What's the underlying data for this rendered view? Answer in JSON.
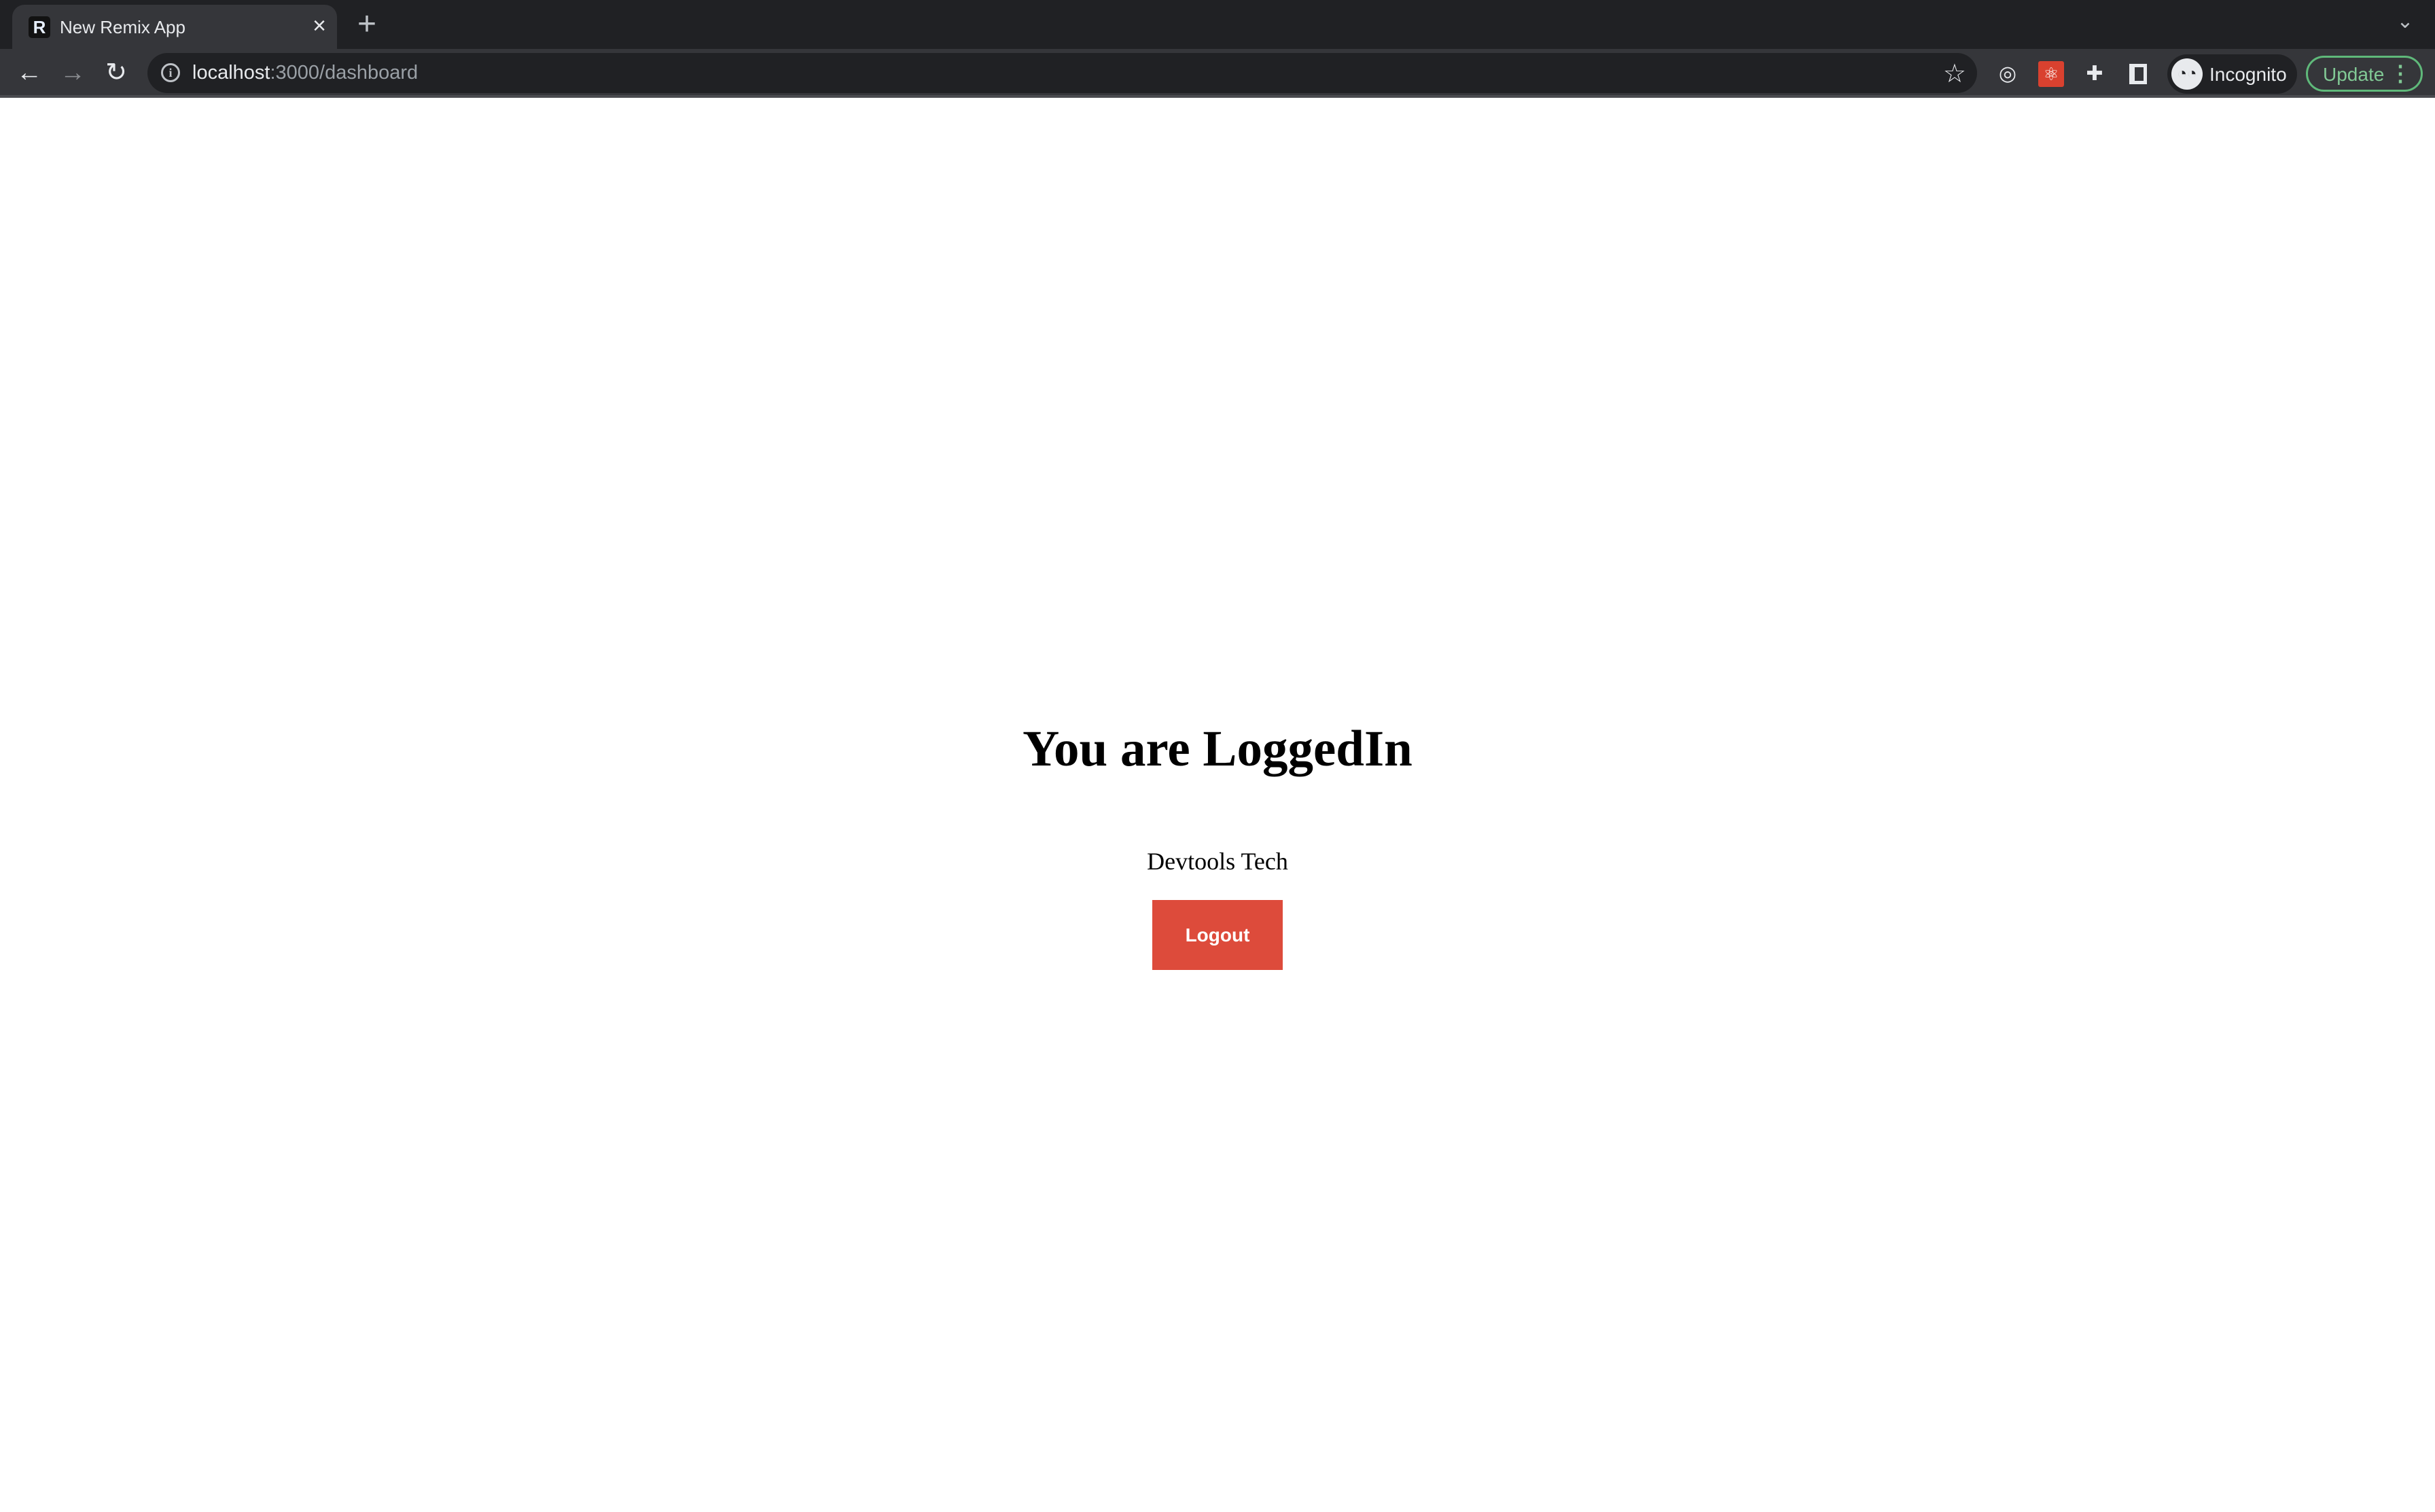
{
  "browser": {
    "tab": {
      "title": "New Remix App",
      "favicon": "R",
      "close": "×"
    },
    "new_tab": "+",
    "tab_search": "⌄",
    "address": {
      "host": "localhost",
      "path": ":3000/dashboard"
    },
    "profile_label": "Incognito",
    "update_label": "Update",
    "icons": [
      "back-icon",
      "forward-icon",
      "reload-icon",
      "info-icon",
      "star-icon",
      "target-extension-icon",
      "react-devtools-icon",
      "puzzle-extensions-icon",
      "side-panel-icon",
      "incognito-icon",
      "more-vert-icon"
    ],
    "colors": {
      "update_accent": "#81c995"
    }
  },
  "page": {
    "heading": "You are LoggedIn",
    "username": "Devtools Tech",
    "logout_label": "Logout",
    "colors": {
      "logout_button": "#dd4b3b"
    }
  }
}
